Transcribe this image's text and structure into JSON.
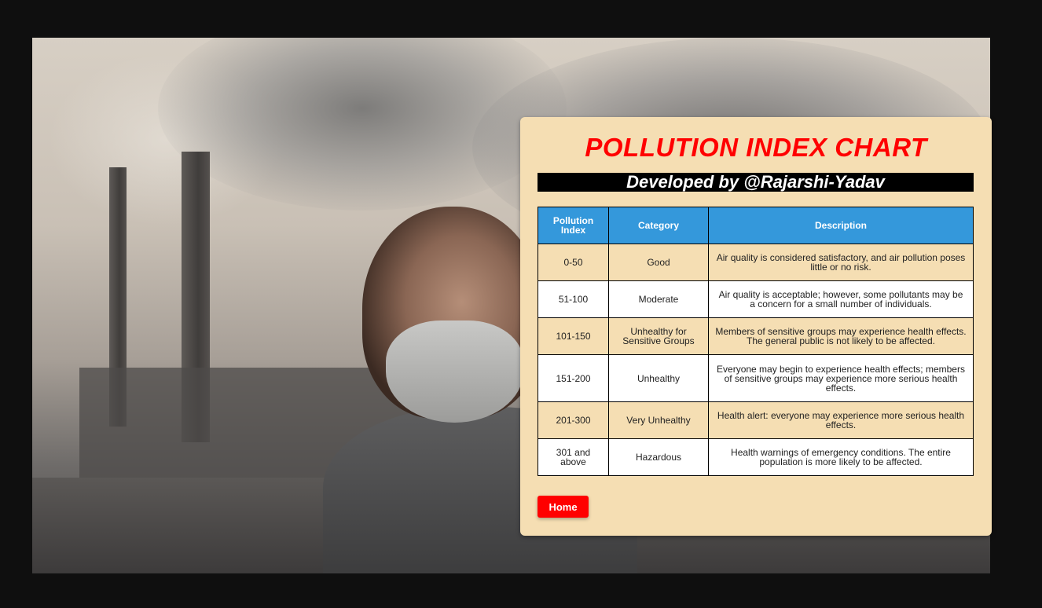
{
  "panel": {
    "title": "POLLUTION INDEX CHART",
    "byline": "Developed by @Rajarshi-Yadav"
  },
  "table": {
    "headers": [
      "Pollution Index",
      "Category",
      "Description"
    ],
    "rows": [
      {
        "index": "0-50",
        "category": "Good",
        "description": "Air quality is considered satisfactory, and air pollution poses little or no risk."
      },
      {
        "index": "51-100",
        "category": "Moderate",
        "description": "Air quality is acceptable; however, some pollutants may be a concern for a small number of individuals."
      },
      {
        "index": "101-150",
        "category": "Unhealthy for Sensitive Groups",
        "description": "Members of sensitive groups may experience health effects. The general public is not likely to be affected."
      },
      {
        "index": "151-200",
        "category": "Unhealthy",
        "description": "Everyone may begin to experience health effects; members of sensitive groups may experience more serious health effects."
      },
      {
        "index": "201-300",
        "category": "Very Unhealthy",
        "description": "Health alert: everyone may experience more serious health effects."
      },
      {
        "index": "301 and above",
        "category": "Hazardous",
        "description": "Health warnings of emergency conditions. The entire population is more likely to be affected."
      }
    ]
  },
  "home_button": {
    "label": "Home"
  },
  "colors": {
    "title": "#ff0000",
    "header_bg": "#3498db",
    "panel_bg": "#f5deb3",
    "button_bg": "#ff0000"
  }
}
